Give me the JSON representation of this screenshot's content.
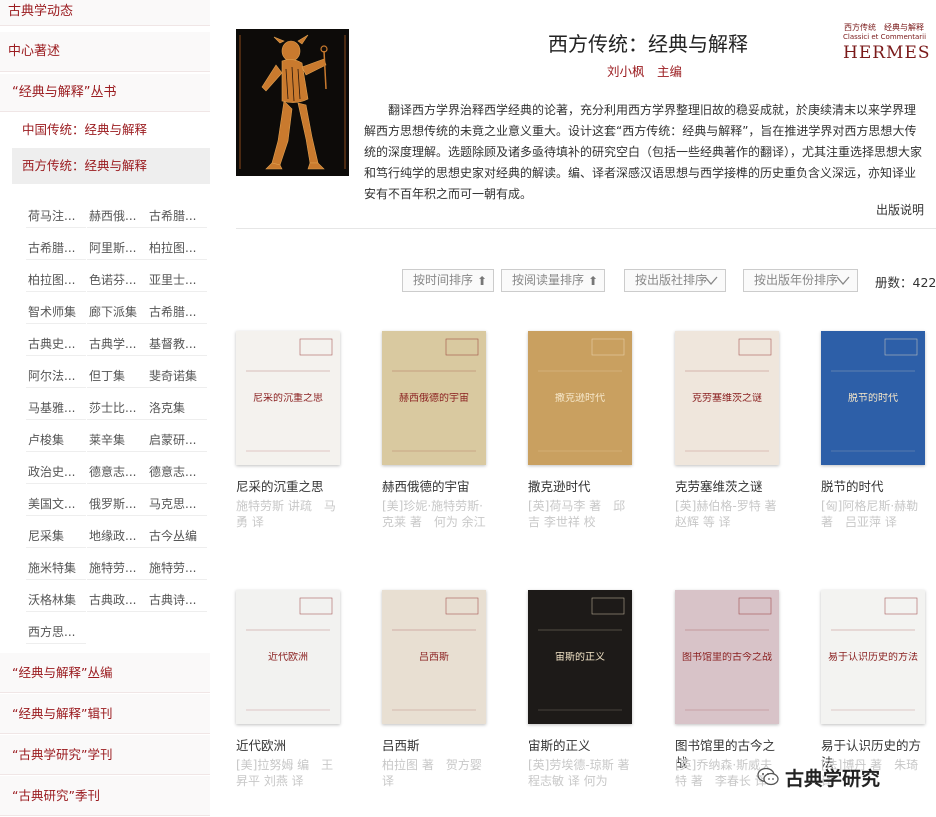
{
  "sidebar": {
    "top_items": [
      {
        "label": "古典学动态"
      },
      {
        "label": "中心著述"
      }
    ],
    "series_heading": "“经典与解释”丛书",
    "sub_items": [
      {
        "label": "中国传统：经典与解释",
        "active": false
      },
      {
        "label": "西方传统：经典与解释",
        "active": true
      }
    ],
    "tags": [
      "荷马注...",
      "赫西俄...",
      "古希腊...",
      "古希腊...",
      "阿里斯...",
      "柏拉图...",
      "柏拉图...",
      "色诺芬...",
      "亚里士...",
      "智术师集",
      "廊下派集",
      "古希腊...",
      "古典史...",
      "古典学...",
      "基督教...",
      "阿尔法...",
      "但丁集",
      "斐奇诺集",
      "马基雅...",
      "莎士比...",
      "洛克集",
      "卢梭集",
      "莱辛集",
      "启蒙研...",
      "政治史...",
      "德意志...",
      "德意志...",
      "美国文...",
      "俄罗斯...",
      "马克思...",
      "尼采集",
      "地缘政...",
      "古今丛编",
      "施米特集",
      "施特劳...",
      "施特劳...",
      "沃格林集",
      "古典政...",
      "古典诗...",
      "西方思..."
    ],
    "bottom_items": [
      {
        "label": "“经典与解释”丛编"
      },
      {
        "label": "“经典与解释”辑刊"
      },
      {
        "label": "“古典学研究”学刊"
      },
      {
        "label": "“古典研究”季刊"
      }
    ]
  },
  "header": {
    "title": "西方传统：经典与解释",
    "editor": "刘小枫　主编",
    "logo_line1": "西方传统　经典与解释",
    "logo_line2": "Classici et Commentarii",
    "logo_line3": "HERMES",
    "description": "翻译西方学界治释西学经典的论著，充分利用西方学界整理旧故的稳妥成就，於庚续清末以来学界理解西方思想传统的未竟之业意义重大。设计这套“西方传统：经典与解释”，旨在推进学界对西方思想大传统的深度理解。选题除顾及诸多亟待填补的研究空白（包括一些经典著作的翻译），尤其注重选择思想大家和笃行纯学的思想史家对经典的解读。编、译者深感汉语思想与西学接榫的历史重负含义深远，亦知译业安有不百年积之而可一朝有成。",
    "pub_note": "出版说明"
  },
  "sortbar": {
    "by_time": "按时间排序",
    "by_reads": "按阅读量排序",
    "by_publisher": "按出版社排序",
    "by_year": "按出版年份排序",
    "count_label": "册数：422"
  },
  "books": [
    {
      "title": "尼采的沉重之思",
      "author": "施特劳斯 讲疏　马勇 译",
      "cover_text": "尼采的沉重之思",
      "cover_bg": "#f4f2ee"
    },
    {
      "title": "赫西俄德的宇宙",
      "author": "[美]珍妮·施特劳斯·克莱 著　何为 余江 译",
      "cover_text": "赫西俄德的宇宙",
      "cover_bg": "#d9c9a0"
    },
    {
      "title": "撒克逊时代",
      "author": "[英]荷马李 著　邱吉 李世祥 校",
      "cover_text": "撒克逊时代",
      "cover_bg": "#c9a060"
    },
    {
      "title": "克劳塞维茨之谜",
      "author": "[英]赫伯格-罗特 著　赵辉 等 译",
      "cover_text": "克劳塞维茨之谜",
      "cover_bg": "#efe6dc"
    },
    {
      "title": "脱节的时代",
      "author": "[匈]阿格尼斯·赫勒 著　吕亚萍 译",
      "cover_text": "脱节的时代",
      "cover_bg": "#2d5fa8"
    },
    {
      "title": "近代欧洲",
      "author": "[美]拉努姆 编　王昇平 刘燕 译",
      "cover_text": "近代欧洲",
      "cover_bg": "#f2f2f0"
    },
    {
      "title": "吕西斯",
      "author": "柏拉图 著　贺方婴 译",
      "cover_text": "吕西斯",
      "cover_bg": "#e8dfd2"
    },
    {
      "title": "宙斯的正义",
      "author": "[英]劳埃德-琼斯 著　程志敏 译 何为",
      "cover_text": "宙斯的正义",
      "cover_bg": "#1d1a18"
    },
    {
      "title": "图书馆里的古今之战",
      "author": "[英]乔纳森·斯威夫特 著　李春长 译",
      "cover_text": "图书馆里的古今之战",
      "cover_bg": "#d8c3c8"
    },
    {
      "title": "易于认识历史的方法",
      "author": "[法]博丹 著　朱琦 译",
      "cover_text": "易于认识历史的方法",
      "cover_bg": "#f3f3f1"
    }
  ],
  "watermark": "古典学研究"
}
